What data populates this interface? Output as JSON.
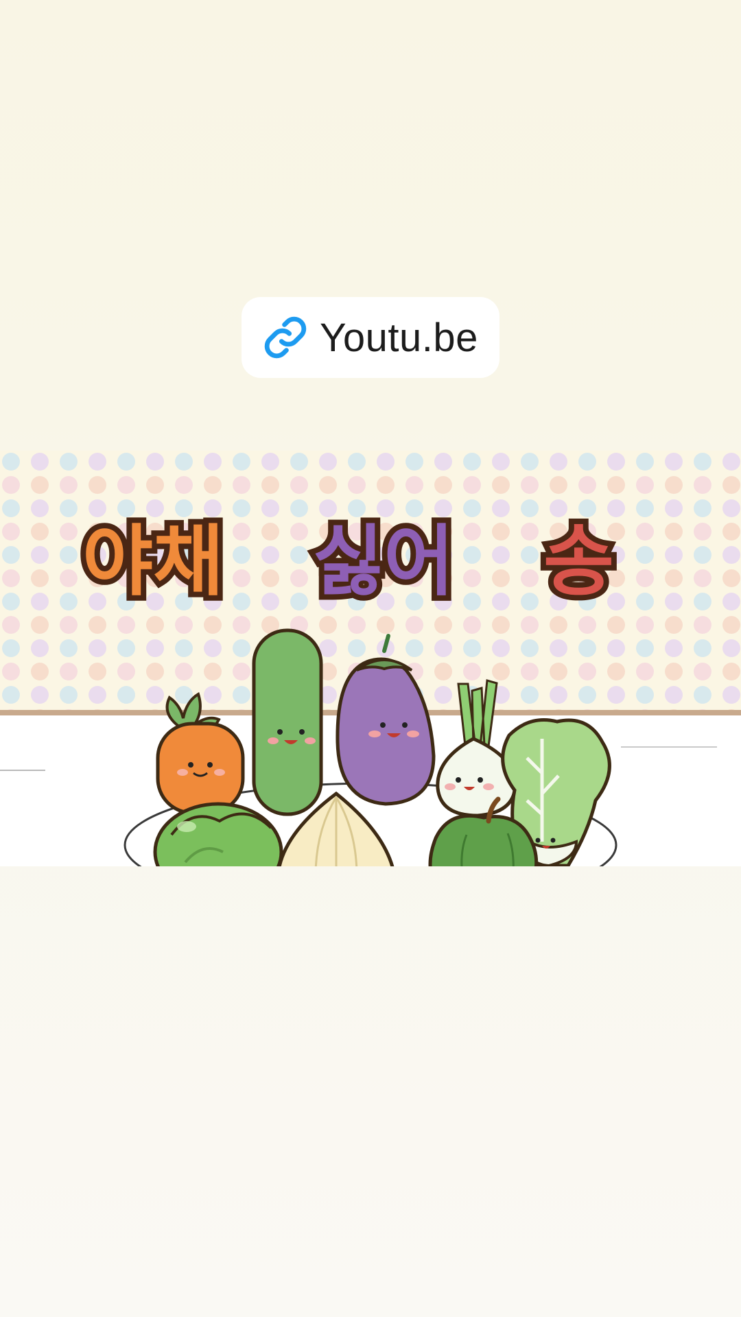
{
  "link_chip": {
    "label": "Youtu.be",
    "icon": "link-icon",
    "icon_color": "#1d9bf0"
  },
  "video": {
    "title_words": [
      "야채",
      "싫어",
      "송"
    ],
    "title_colors": [
      "#f08a3a",
      "#6fa84e",
      "#8e5fb5",
      "#d9544b"
    ],
    "outline_color": "#4a2614",
    "background_color": "#fbf6e4",
    "characters": [
      "carrot",
      "cucumber",
      "eggplant",
      "green-onion",
      "cabbage",
      "lettuce",
      "onion",
      "bell-pepper"
    ]
  }
}
